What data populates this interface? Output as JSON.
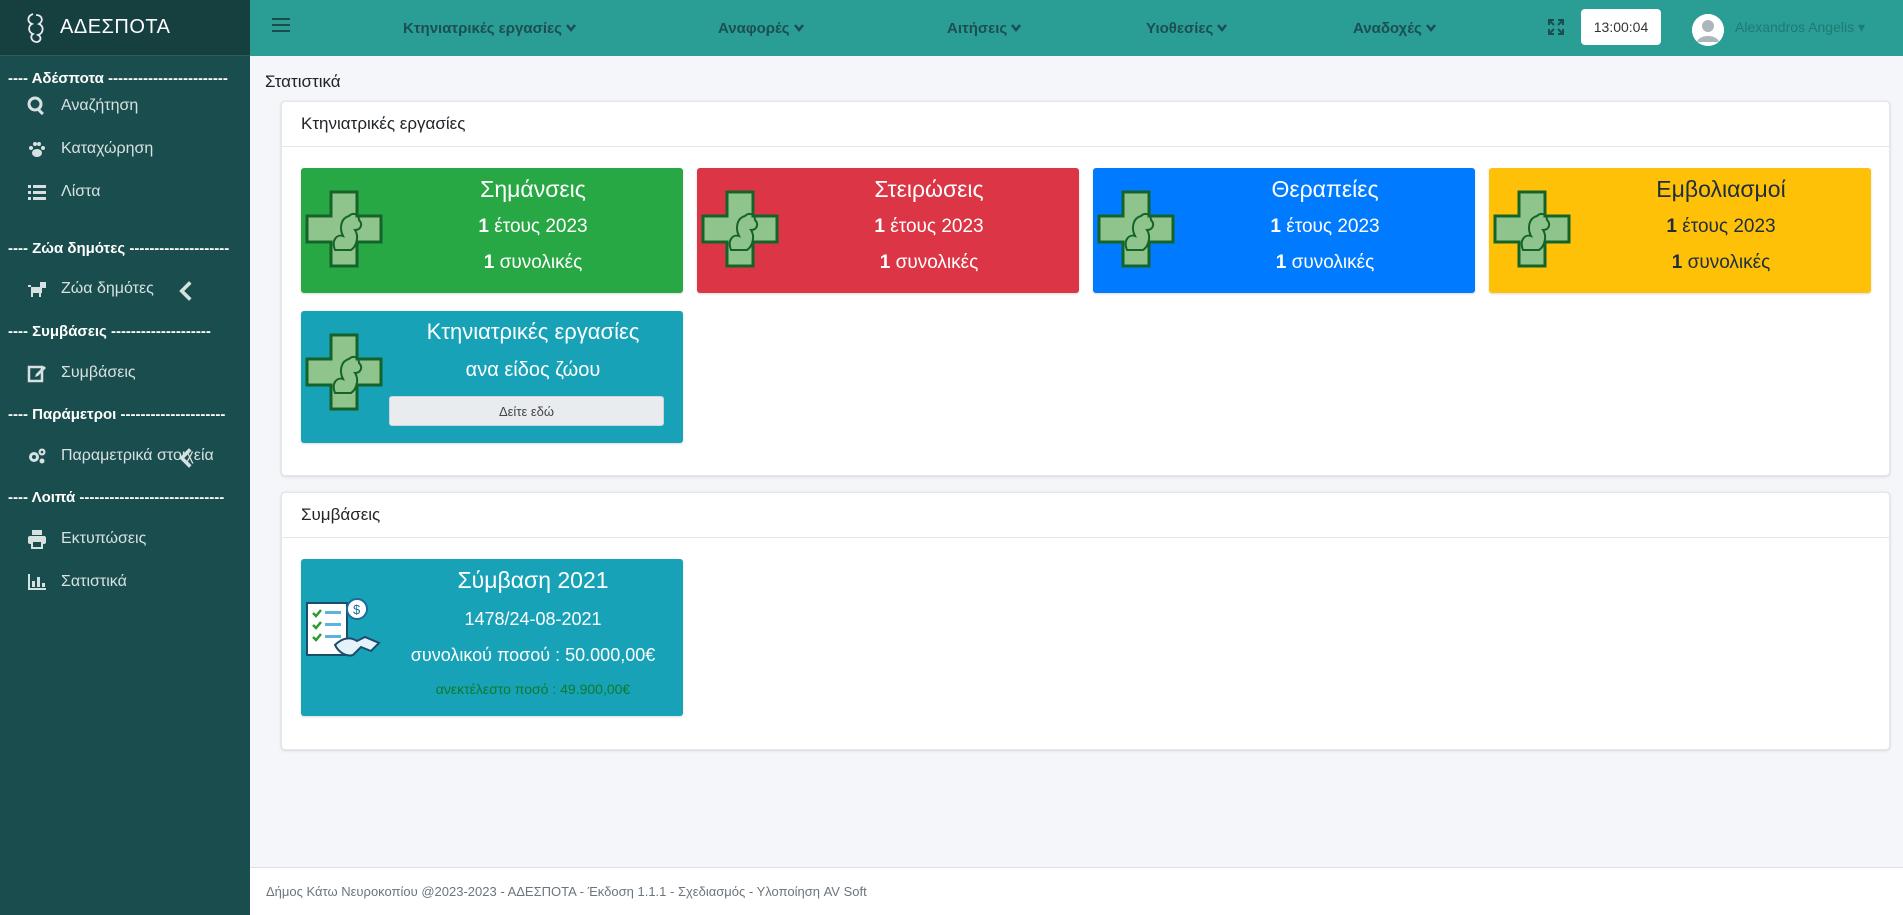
{
  "brand": {
    "title": "ΑΔΕΣΠΟΤΑ"
  },
  "sidebar": {
    "sections": [
      "---- Αδέσποτα ------------------------",
      "---- Ζώα δημότες --------------------",
      "---- Συμβάσεις --------------------",
      "---- Παράμετροι ---------------------",
      "---- Λοιπά -----------------------------"
    ],
    "items": [
      {
        "label": "Αναζήτηση",
        "icon": "search-icon"
      },
      {
        "label": "Καταχώρηση",
        "icon": "paw-icon"
      },
      {
        "label": "Λίστα",
        "icon": "list-icon"
      },
      {
        "label": "Ζώα δημότες",
        "icon": "dog-icon"
      },
      {
        "label": "Συμβάσεις",
        "icon": "edit-icon"
      },
      {
        "label": "Παραμετρικά στοιχεία",
        "icon": "cogs-icon"
      },
      {
        "label": "Εκτυπώσεις",
        "icon": "print-icon"
      },
      {
        "label": "Σατιστικά",
        "icon": "chart-bar-icon"
      }
    ]
  },
  "topnav": {
    "menus": [
      "Κτηνιατρικές εργασίες",
      "Αναφορές",
      "Αιτήσεις",
      "Υιοθεσίες",
      "Αναδοχές"
    ],
    "clock": "13:00:04",
    "user": "Alexandros Angelis"
  },
  "page": {
    "title": "Στατιστικά"
  },
  "vet_card": {
    "header": "Κτηνιατρικές εργασίες",
    "tiles": [
      {
        "title": "Σημάνσεις",
        "year_count": "1",
        "year_label": " έτους 2023",
        "total_count": "1",
        "total_label": " συνολικές",
        "color": "#28a745"
      },
      {
        "title": "Στειρώσεις",
        "year_count": "1",
        "year_label": " έτους 2023",
        "total_count": "1",
        "total_label": " συνολικές",
        "color": "#dc3545"
      },
      {
        "title": "Θεραπείες",
        "year_count": "1",
        "year_label": " έτους 2023",
        "total_count": "1",
        "total_label": " συνολικές",
        "color": "#007bff"
      },
      {
        "title": "Εμβολιασμοί",
        "year_count": "1",
        "year_label": " έτους 2023",
        "total_count": "1",
        "total_label": " συνολικές",
        "color": "#ffc107"
      }
    ],
    "species_tile": {
      "title": "Κτηνιατρικές εργασίες",
      "subtitle": "ανα είδος ζώου",
      "button": "Δείτε εδώ",
      "color": "#17a2b8"
    }
  },
  "contracts_card": {
    "header": "Συμβάσεις",
    "tile": {
      "title": "Σύμβαση 2021",
      "reference": "1478/24-08-2021",
      "total": "συνολικού ποσού : 50.000,00€",
      "unfinished": "ανεκτέλεστο ποσό : 49.900,00€"
    }
  },
  "footer": {
    "text": "Δήμος Κάτω Νευροκοπίου @2023-2023 - ΑΔΕΣΠΟΤΑ - Έκδοση 1.1.1 - Σχεδιασμός - Υλοποίηση AV Soft"
  }
}
